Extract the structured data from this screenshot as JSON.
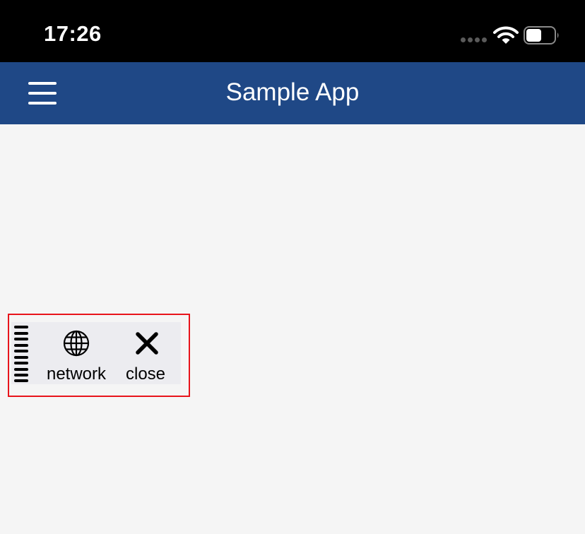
{
  "status_bar": {
    "time": "17:26",
    "icons": [
      "signal-icon",
      "wifi-icon",
      "battery-icon"
    ],
    "battery_level": 0.55
  },
  "nav_bar": {
    "title": "Sample App",
    "menu_icon": "hamburger-menu-icon",
    "background": "#1f4886"
  },
  "floating_toolbar": {
    "handle_icon": "drag-handle-icon",
    "buttons": [
      {
        "label": "network",
        "icon": "globe-icon"
      },
      {
        "label": "close",
        "icon": "close-icon"
      }
    ],
    "highlight_color": "#e8141b"
  }
}
